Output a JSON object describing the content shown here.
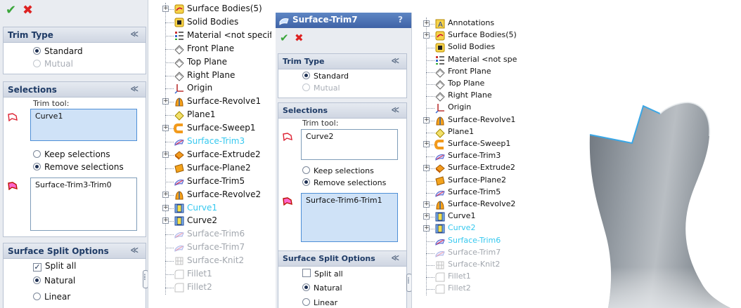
{
  "panel1": {
    "ok_icon": "checkmark-icon",
    "cancel_icon": "x-icon",
    "trim_type": {
      "title": "Trim Type",
      "standard": "Standard",
      "mutual": "Mutual"
    },
    "selections": {
      "title": "Selections",
      "trim_tool_label": "Trim tool:",
      "trim_tool_value": "Curve1",
      "keep": "Keep selections",
      "remove": "Remove selections",
      "pieces_value": "Surface-Trim3-Trim0"
    },
    "split": {
      "title": "Surface Split Options",
      "split_all": "Split all",
      "split_all_checked": true,
      "natural": "Natural",
      "linear": "Linear"
    }
  },
  "tree1": {
    "items": [
      {
        "label": "Surface Bodies(5)",
        "icon": "surface-bodies-icon",
        "state": "normal"
      },
      {
        "label": "Solid Bodies",
        "icon": "solid-bodies-icon",
        "state": "normal"
      },
      {
        "label": "Material <not specifi",
        "icon": "material-icon",
        "state": "normal"
      },
      {
        "label": "Front Plane",
        "icon": "plane-icon",
        "state": "normal"
      },
      {
        "label": "Top Plane",
        "icon": "plane-icon",
        "state": "normal"
      },
      {
        "label": "Right Plane",
        "icon": "plane-icon",
        "state": "normal"
      },
      {
        "label": "Origin",
        "icon": "origin-icon",
        "state": "normal"
      },
      {
        "label": "Surface-Revolve1",
        "icon": "revolve-icon",
        "state": "normal"
      },
      {
        "label": "Plane1",
        "icon": "plane-feature-icon",
        "state": "normal"
      },
      {
        "label": "Surface-Sweep1",
        "icon": "sweep-icon",
        "state": "normal"
      },
      {
        "label": "Surface-Trim3",
        "icon": "trim-icon",
        "state": "selected"
      },
      {
        "label": "Surface-Extrude2",
        "icon": "extrude-icon",
        "state": "normal"
      },
      {
        "label": "Surface-Plane2",
        "icon": "planar-surface-icon",
        "state": "normal"
      },
      {
        "label": "Surface-Trim5",
        "icon": "trim-icon",
        "state": "normal"
      },
      {
        "label": "Surface-Revolve2",
        "icon": "revolve-icon",
        "state": "normal"
      },
      {
        "label": "Curve1",
        "icon": "curve-icon",
        "state": "selected"
      },
      {
        "label": "Curve2",
        "icon": "curve-icon",
        "state": "normal"
      },
      {
        "label": "Surface-Trim6",
        "icon": "trim-icon",
        "state": "suppressed"
      },
      {
        "label": "Surface-Trim7",
        "icon": "trim-icon",
        "state": "suppressed"
      },
      {
        "label": "Surface-Knit2",
        "icon": "knit-icon",
        "state": "suppressed"
      },
      {
        "label": "Fillet1",
        "icon": "fillet-icon",
        "state": "suppressed"
      },
      {
        "label": "Fillet2",
        "icon": "fillet-icon",
        "state": "suppressed"
      }
    ]
  },
  "panel2": {
    "title": "Surface-Trim7",
    "help": "?",
    "trim_type": {
      "title": "Trim Type",
      "standard": "Standard",
      "mutual": "Mutual"
    },
    "selections": {
      "title": "Selections",
      "trim_tool_label": "Trim tool:",
      "trim_tool_value": "Curve2",
      "keep": "Keep selections",
      "remove": "Remove selections",
      "pieces_value": "Surface-Trim6-Trim1"
    },
    "split": {
      "title": "Surface Split Options",
      "split_all": "Split all",
      "split_all_checked": false,
      "natural": "Natural",
      "linear": "Linear"
    }
  },
  "tree2": {
    "items": [
      {
        "label": "Annotations",
        "icon": "annotations-icon",
        "state": "normal"
      },
      {
        "label": "Surface Bodies(5)",
        "icon": "surface-bodies-icon",
        "state": "normal"
      },
      {
        "label": "Solid Bodies",
        "icon": "solid-bodies-icon",
        "state": "normal"
      },
      {
        "label": "Material <not specif",
        "icon": "material-icon",
        "state": "normal"
      },
      {
        "label": "Front Plane",
        "icon": "plane-icon",
        "state": "normal"
      },
      {
        "label": "Top Plane",
        "icon": "plane-icon",
        "state": "normal"
      },
      {
        "label": "Right Plane",
        "icon": "plane-icon",
        "state": "normal"
      },
      {
        "label": "Origin",
        "icon": "origin-icon",
        "state": "normal"
      },
      {
        "label": "Surface-Revolve1",
        "icon": "revolve-icon",
        "state": "normal"
      },
      {
        "label": "Plane1",
        "icon": "plane-feature-icon",
        "state": "normal"
      },
      {
        "label": "Surface-Sweep1",
        "icon": "sweep-icon",
        "state": "normal"
      },
      {
        "label": "Surface-Trim3",
        "icon": "trim-icon",
        "state": "normal"
      },
      {
        "label": "Surface-Extrude2",
        "icon": "extrude-icon",
        "state": "normal"
      },
      {
        "label": "Surface-Plane2",
        "icon": "planar-surface-icon",
        "state": "normal"
      },
      {
        "label": "Surface-Trim5",
        "icon": "trim-icon",
        "state": "normal"
      },
      {
        "label": "Surface-Revolve2",
        "icon": "revolve-icon",
        "state": "normal"
      },
      {
        "label": "Curve1",
        "icon": "curve-icon",
        "state": "normal"
      },
      {
        "label": "Curve2",
        "icon": "curve-icon",
        "state": "selected"
      },
      {
        "label": "Surface-Trim6",
        "icon": "trim-icon",
        "state": "selected"
      },
      {
        "label": "Surface-Trim7",
        "icon": "trim-icon",
        "state": "suppressed"
      },
      {
        "label": "Surface-Knit2",
        "icon": "knit-icon",
        "state": "suppressed"
      },
      {
        "label": "Fillet1",
        "icon": "fillet-icon",
        "state": "suppressed"
      },
      {
        "label": "Fillet2",
        "icon": "fillet-icon",
        "state": "suppressed"
      }
    ]
  },
  "colors": {
    "selected_text": "#35c8ef",
    "suppressed_text": "#a2a7ae",
    "header_blue": "#3f63a6",
    "model_gray": "#8e959c",
    "edge_highlight": "#3aa7e6"
  }
}
